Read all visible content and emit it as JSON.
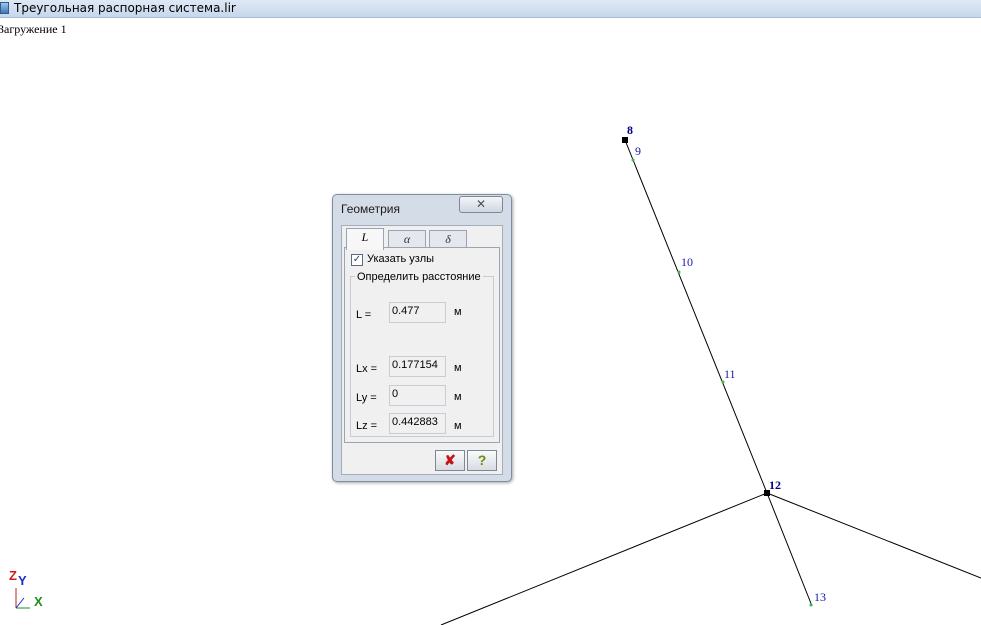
{
  "window": {
    "title": "Треугольная распорная система.lir"
  },
  "viewport": {
    "load_case": "Загружение 1",
    "nodes": {
      "n8": "8",
      "n9": "9",
      "n10": "10",
      "n11": "11",
      "n12": "12",
      "n13": "13"
    },
    "axes": {
      "z": "Z",
      "y": "Y",
      "x": "X"
    }
  },
  "dialog": {
    "title": "Геометрия",
    "close_symbol": "✕",
    "tabs": [
      {
        "label": "L",
        "active": true
      },
      {
        "label": "α",
        "active": false
      },
      {
        "label": "δ",
        "active": false
      }
    ],
    "show_nodes": {
      "label": "Указать узлы",
      "checked": true
    },
    "group_title": "Определить расстояние",
    "rows": {
      "L": {
        "label": "L  =",
        "value": "0.477",
        "unit": "м"
      },
      "Lx": {
        "label": "Lx =",
        "value": "0.177154",
        "unit": "м"
      },
      "Ly": {
        "label": "Ly =",
        "value": "0",
        "unit": "м"
      },
      "Lz": {
        "label": "Lz =",
        "value": "0.442883",
        "unit": "м"
      }
    },
    "buttons": {
      "cancel": "✘",
      "help": "?"
    }
  },
  "colors": {
    "node_label": "#1a1aa8",
    "node_point": "#3cb84a",
    "member": "#000000"
  }
}
